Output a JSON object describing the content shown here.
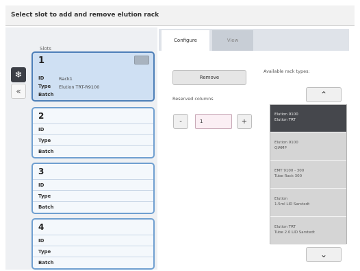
{
  "title": "Select slot to add and remove elution rack",
  "slots_label": "Slots",
  "slots": [
    {
      "number": "1",
      "id_label": "ID",
      "id_value": "Rack1",
      "type_label": "Type",
      "type_value": "Elution TRT-R9100",
      "batch_label": "Batch"
    },
    {
      "number": "2",
      "id_label": "ID",
      "id_value": "",
      "type_label": "Type",
      "type_value": "",
      "batch_label": "Batch"
    },
    {
      "number": "3",
      "id_label": "ID",
      "id_value": "",
      "type_label": "Type",
      "type_value": "",
      "batch_label": "Batch"
    },
    {
      "number": "4",
      "id_label": "ID",
      "id_value": "",
      "type_label": "Type",
      "type_value": "",
      "batch_label": "Batch"
    }
  ],
  "tabs": {
    "configure": "Configure",
    "view": "View"
  },
  "remove_label": "Remove",
  "reserved_columns_label": "Reserved columns",
  "reserved_value": "1",
  "minus_label": "-",
  "plus_label": "+",
  "available_label": "Available rack types:",
  "rack_types": [
    {
      "line1": "Elution 9100",
      "line2": "Elution TRT"
    },
    {
      "line1": "Elution 9100",
      "line2": "QIAMP"
    },
    {
      "line1": "EMT 9100 - 300",
      "line2": "Tube Rack 300"
    },
    {
      "line1": "Elution",
      "line2": "1.5ml LID Sarstedt"
    },
    {
      "line1": "Elution TRT",
      "line2": "Tube 2.0 LID Sarstedt"
    }
  ],
  "icons": {
    "snowflake": "❄",
    "collapse": "«",
    "up": "⌃",
    "down": "⌄"
  }
}
